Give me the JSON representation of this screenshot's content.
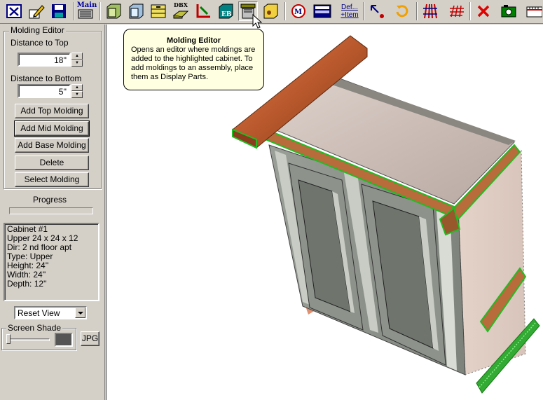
{
  "toolbar": {
    "main_label": "Main",
    "dbx_label": "DBX",
    "eb_label": "EB",
    "def_label": "Def...",
    "item_label": "+Item"
  },
  "tooltip": {
    "title": "Molding Editor",
    "line1": "Opens an editor where moldings are",
    "line2": "added to the highlighted cabinet. To",
    "line3": "add moldings to an assembly, place",
    "line4": "them as Display Parts."
  },
  "panel": {
    "group_title": "Molding Editor",
    "distance_top_label": "Distance to Top",
    "distance_top_value": "18''",
    "distance_bottom_label": "Distance to Bottom",
    "distance_bottom_value": "5''",
    "buttons": {
      "add_top": "Add Top Molding",
      "add_mid": "Add Mid Molding",
      "add_base": "Add Base Molding",
      "delete": "Delete",
      "select": "Select Molding"
    },
    "progress_label": "Progress",
    "info": {
      "line1": "Cabinet #1",
      "line2": "Upper 24 x 24 x 12",
      "line3": "Dir: 2 nd floor apt",
      "line4": "Type: Upper",
      "line5": "Height: 24''",
      "line6": "Width: 24''",
      "line7": "Depth: 12''"
    },
    "view_select": "Reset View",
    "screen_shade_label": "Screen Shade",
    "jpg_label": "JPG"
  }
}
